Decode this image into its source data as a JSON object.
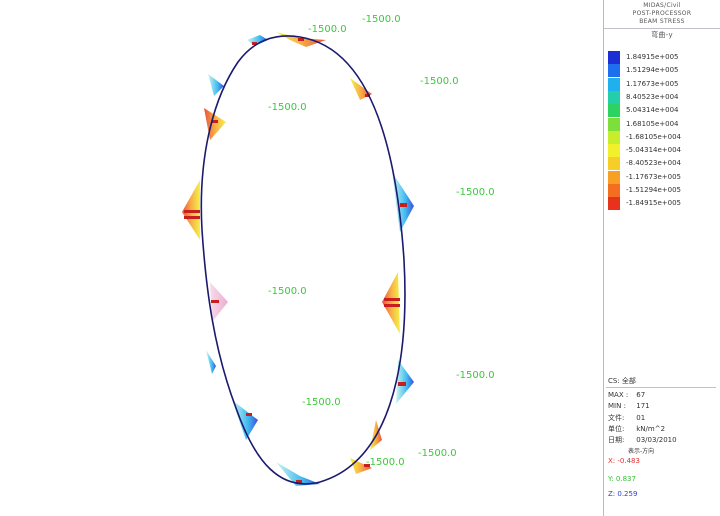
{
  "header": {
    "line1": "MIDAS/Civil",
    "line2": "POST-PROCESSOR",
    "line3": "BEAM STRESS"
  },
  "legend": {
    "title": "弯曲-y",
    "entries": [
      {
        "value": "1.84915e+005",
        "color": "#1c2fd6"
      },
      {
        "value": "1.51294e+005",
        "color": "#1e6ff0"
      },
      {
        "value": "1.17673e+005",
        "color": "#1fb0ee"
      },
      {
        "value": "8.40523e+004",
        "color": "#22cfa8"
      },
      {
        "value": "5.04314e+004",
        "color": "#2cd360"
      },
      {
        "value": "1.68105e+004",
        "color": "#7de03a"
      },
      {
        "value": "-1.68105e+004",
        "color": "#c6ee2d"
      },
      {
        "value": "-5.04314e+004",
        "color": "#f2f02b"
      },
      {
        "value": "-8.40523e+004",
        "color": "#f7cd28"
      },
      {
        "value": "-1.17673e+005",
        "color": "#f7a024"
      },
      {
        "value": "-1.51294e+005",
        "color": "#f56e20"
      },
      {
        "value": "-1.84915e+005",
        "color": "#e7321c"
      }
    ]
  },
  "info": {
    "stage": "CS: 全部",
    "max_label": "MAX :",
    "max_value": "67",
    "min_label": "MIN :",
    "min_value": "171",
    "file_label": "文件:",
    "file_value": "01",
    "unit_label": "单位:",
    "unit_value": "kN/m^2",
    "date_label": "日期:",
    "date_value": "03/03/2010",
    "view_label": "表示-方向",
    "view_x": "X: -0.483",
    "view_y": "Y: 0.837",
    "view_z": "Z: 0.259"
  },
  "colors": {
    "outline": "#1a1a6e",
    "label_green": "#3cc83c",
    "red_mark": "#c81e1e",
    "view_x": "#e03030",
    "view_y": "#30c030",
    "view_z": "#3040d0"
  },
  "diagram": {
    "load_labels": [
      "-1500.0",
      "-1500.0",
      "-1500.0",
      "-1500.0",
      "-1500.0",
      "-1500.0",
      "-1500.0",
      "-1500.0",
      "-1500.0",
      "-1500.0",
      "-1500.0"
    ]
  }
}
